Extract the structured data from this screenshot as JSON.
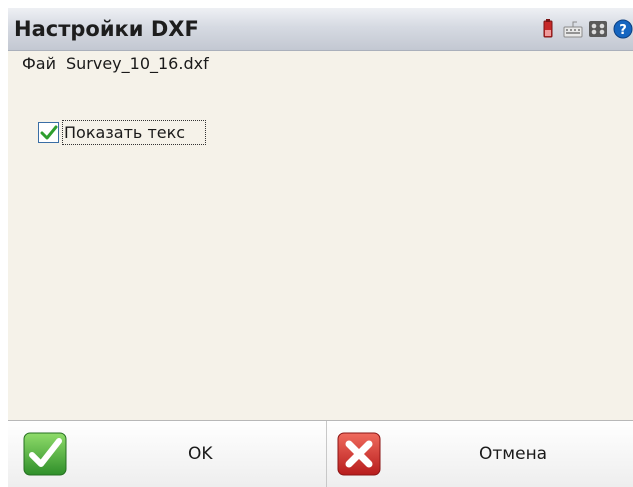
{
  "titlebar": {
    "title": "Настройки DXF"
  },
  "tray": {
    "icons": [
      "battery-icon",
      "keyboard-icon",
      "status-icon",
      "help-icon"
    ]
  },
  "form": {
    "file_label": "Фай",
    "file_value": "Survey_10_16.dxf",
    "show_text_label": "Показать текс",
    "show_text_checked": true
  },
  "buttons": {
    "ok_label": "OK",
    "cancel_label": "Отмена"
  },
  "colors": {
    "content_bg": "#f5f2e9",
    "ok_green": "#3fa33a",
    "cancel_red": "#d32f2f"
  }
}
